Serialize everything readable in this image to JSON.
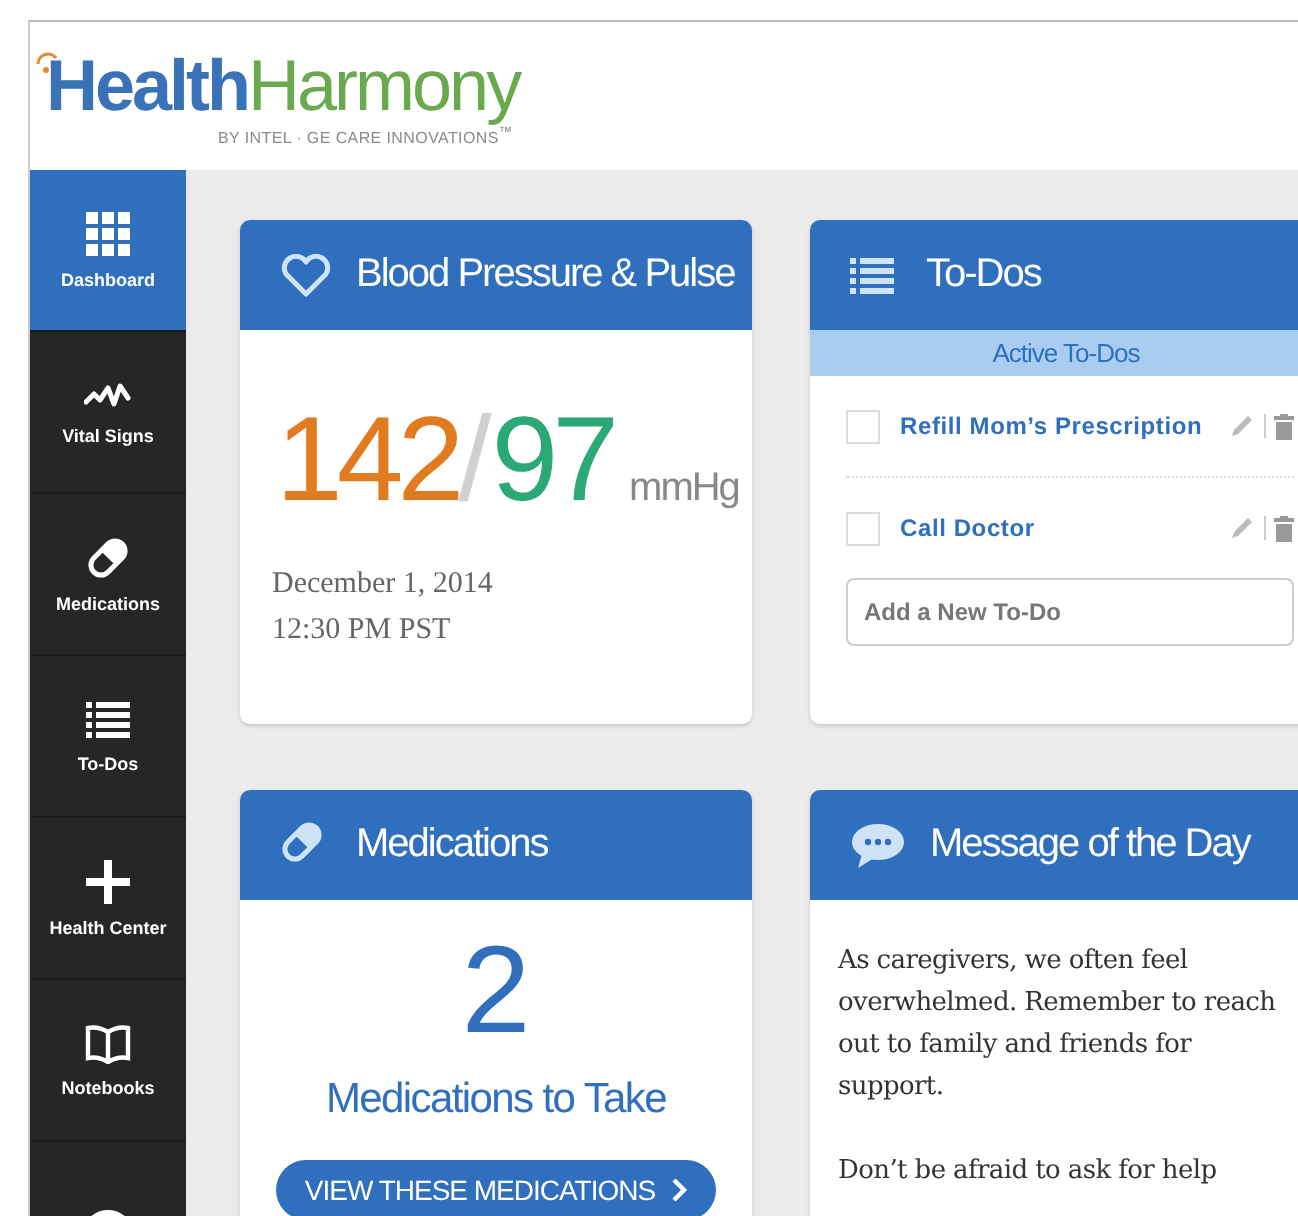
{
  "logo": {
    "brand_primary": "Health",
    "brand_secondary": "Harmony",
    "tagline": "BY INTEL · GE CARE INNOVATIONS$^{™}$"
  },
  "sidebar": {
    "items": [
      {
        "label": "Dashboard",
        "selected": true
      },
      {
        "label": "Vital Signs",
        "selected": false
      },
      {
        "label": "Medications",
        "selected": false
      },
      {
        "label": "To-Dos",
        "selected": false
      },
      {
        "label": "Health Center",
        "selected": false
      },
      {
        "label": "Notebooks",
        "selected": false
      },
      {
        "selected": false
      }
    ]
  },
  "blood_pressure": {
    "title": "Blood Pressure & Pulse",
    "systolic": "142",
    "separator": "/",
    "diastolic": "97",
    "unit": "mmHg",
    "date": "December 1, 2014",
    "time": "12:30 PM PST"
  },
  "todos": {
    "title": "To-Dos",
    "subtitle": "Active To-Dos",
    "items": [
      {
        "text": "Refill Mom’s Prescription",
        "checked": false
      },
      {
        "text": "Call Doctor",
        "checked": false
      }
    ],
    "new_todo": {
      "placeholder": "Add a New To-Do"
    }
  },
  "medications": {
    "title": "Medications",
    "count": "2",
    "caption": "Medications to Take",
    "button": "VIEW THESE MEDICATIONS"
  },
  "message_of_the_day": {
    "title": "Message of the Day",
    "paragraphs": [
      "As caregivers, we often feel overwhelmed. Remember to reach out to family and friends for support.",
      "Don’t be afraid to ask for help"
    ]
  }
}
